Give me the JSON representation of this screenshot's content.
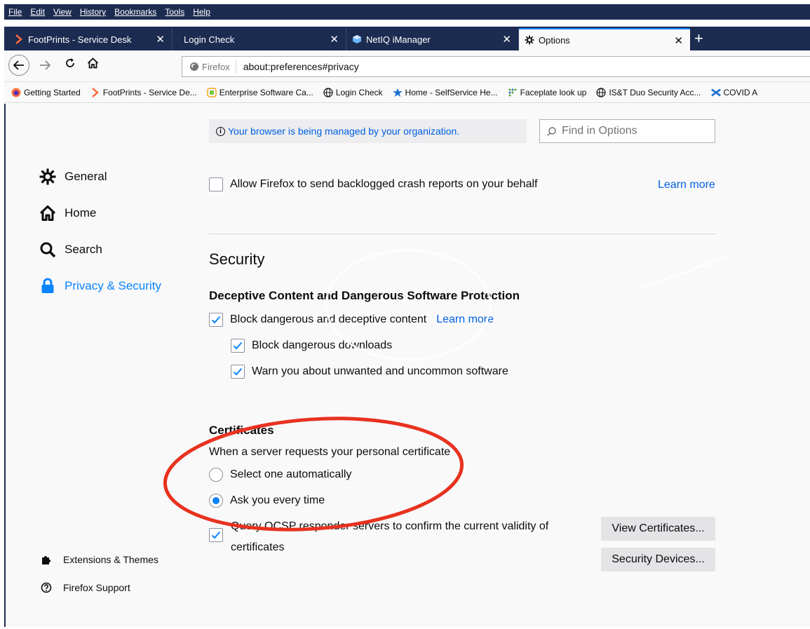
{
  "menubar": {
    "items": [
      "File",
      "Edit",
      "View",
      "History",
      "Bookmarks",
      "Tools",
      "Help"
    ]
  },
  "tabs": [
    {
      "label": "FootPrints - Service Desk",
      "icon": "footprints-icon"
    },
    {
      "label": "Login Check",
      "icon": ""
    },
    {
      "label": "NetIQ iManager",
      "icon": "netiq-icon"
    },
    {
      "label": "Options",
      "icon": "gear-icon",
      "active": true
    }
  ],
  "navbar": {
    "identity_label": "Firefox",
    "url": "about:preferences#privacy"
  },
  "bookmarks": [
    {
      "label": "Getting Started",
      "icon": "firefox-icon"
    },
    {
      "label": "FootPrints - Service De...",
      "icon": "footprints-icon"
    },
    {
      "label": "Enterprise Software Ca...",
      "icon": "catalog-icon"
    },
    {
      "label": "Login Check",
      "icon": "globe-icon"
    },
    {
      "label": "Home - SelfService He...",
      "icon": "star-icon"
    },
    {
      "label": "Faceplate look up",
      "icon": "dots-icon"
    },
    {
      "label": "IS&T Duo Security Acc...",
      "icon": "globe-icon"
    },
    {
      "label": "COVID A",
      "icon": "covid-icon"
    }
  ],
  "managed_notice": "Your browser is being managed by your organization.",
  "search": {
    "placeholder": "Find in Options"
  },
  "sidebar": {
    "categories": [
      {
        "label": "General",
        "icon": "gear-icon"
      },
      {
        "label": "Home",
        "icon": "home-icon"
      },
      {
        "label": "Search",
        "icon": "search-icon"
      },
      {
        "label": "Privacy & Security",
        "icon": "lock-icon",
        "selected": true
      }
    ],
    "footer": [
      {
        "label": "Extensions & Themes",
        "icon": "puzzle-icon"
      },
      {
        "label": "Firefox Support",
        "icon": "help-icon"
      }
    ]
  },
  "crash_reports": {
    "label": "Allow Firefox to send backlogged crash reports on your behalf",
    "checked": false,
    "learn_more": "Learn more"
  },
  "security": {
    "heading": "Security",
    "deceptive_heading": "Deceptive Content and Dangerous Software Protection",
    "block_dangerous": {
      "label": "Block dangerous and deceptive content",
      "checked": true,
      "learn_more": "Learn more"
    },
    "block_downloads": {
      "label": "Block dangerous downloads",
      "checked": true
    },
    "warn_unwanted": {
      "label": "Warn you about unwanted and uncommon software",
      "checked": true
    }
  },
  "certificates": {
    "heading": "Certificates",
    "description": "When a server requests your personal certificate",
    "select_auto": {
      "label": "Select one automatically",
      "selected": false
    },
    "ask_every": {
      "label": "Ask you every time",
      "selected": true
    },
    "ocsp": {
      "label_line1": "Query OCSP responder servers to confirm the current validity of",
      "label_line2": "certificates",
      "checked": true
    },
    "view_button": "View Certificates...",
    "devices_button": "Security Devices..."
  },
  "colors": {
    "chrome_dark": "#1c2b50",
    "accent_blue": "#0a84ff",
    "link_blue": "#0060df",
    "annotation_red": "#e8321f"
  }
}
